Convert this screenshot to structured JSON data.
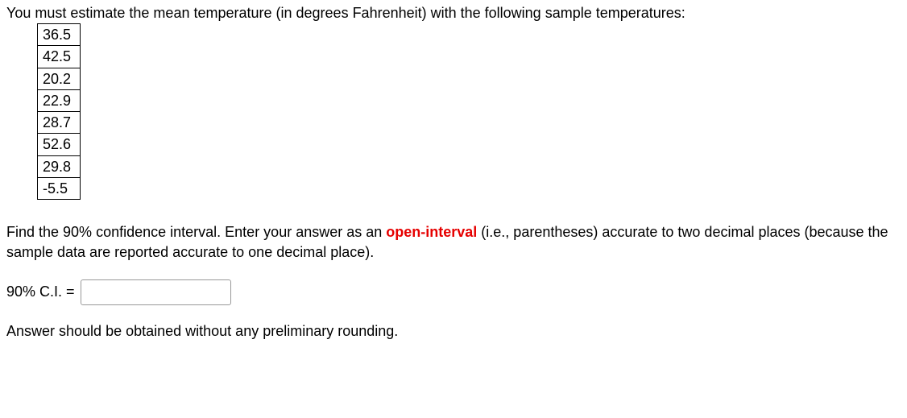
{
  "intro_text": "You must estimate the mean temperature (in degrees Fahrenheit) with the following sample temperatures:",
  "sample_values": [
    "36.5",
    "42.5",
    "20.2",
    "22.9",
    "28.7",
    "52.6",
    "29.8",
    "-5.5"
  ],
  "instructions_prefix": "Find the 90% confidence interval. Enter your answer as an ",
  "open_interval_text": "open-interval",
  "instructions_suffix": " (i.e., parentheses) accurate to two decimal places (because the sample data are reported accurate to one decimal place).",
  "answer_label": "90% C.I. = ",
  "answer_value": "",
  "note_text": "Answer should be obtained without any preliminary rounding."
}
